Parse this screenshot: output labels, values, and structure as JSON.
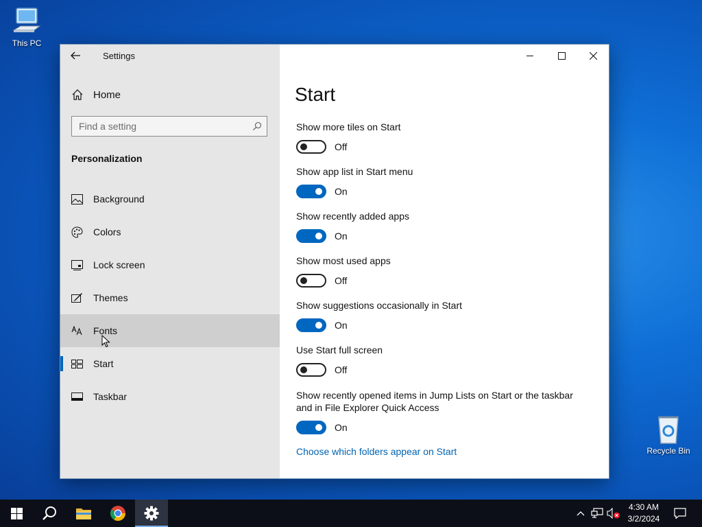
{
  "desktop": {
    "icons": [
      {
        "label": "This PC",
        "icon": "computer-icon"
      },
      {
        "label": "Recycle Bin",
        "icon": "recycle-bin-icon"
      }
    ]
  },
  "window": {
    "title": "Settings",
    "controls": [
      "minimize-icon",
      "maximize-icon",
      "close-icon"
    ]
  },
  "sidebar": {
    "home_label": "Home",
    "search_placeholder": "Find a setting",
    "section_title": "Personalization",
    "items": [
      {
        "label": "Background",
        "icon": "image-icon"
      },
      {
        "label": "Colors",
        "icon": "palette-icon"
      },
      {
        "label": "Lock screen",
        "icon": "lock-screen-icon"
      },
      {
        "label": "Themes",
        "icon": "brush-icon"
      },
      {
        "label": "Fonts",
        "icon": "fonts-icon",
        "hovered": true
      },
      {
        "label": "Start",
        "icon": "start-layout-icon",
        "selected": true
      },
      {
        "label": "Taskbar",
        "icon": "taskbar-icon"
      }
    ]
  },
  "main": {
    "title": "Start",
    "settings": [
      {
        "label": "Show more tiles on Start",
        "state": "Off"
      },
      {
        "label": "Show app list in Start menu",
        "state": "On"
      },
      {
        "label": "Show recently added apps",
        "state": "On"
      },
      {
        "label": "Show most used apps",
        "state": "Off"
      },
      {
        "label": "Show suggestions occasionally in Start",
        "state": "On"
      },
      {
        "label": "Use Start full screen",
        "state": "Off"
      },
      {
        "label_line1": "Show recently opened items in Jump Lists on Start or the taskbar",
        "label_line2": "and in File Explorer Quick Access",
        "state": "On"
      }
    ],
    "link": "Choose which folders appear on Start"
  },
  "taskbar": {
    "time": "4:30 AM",
    "date": "3/2/2024",
    "accent": "#0067c0"
  }
}
